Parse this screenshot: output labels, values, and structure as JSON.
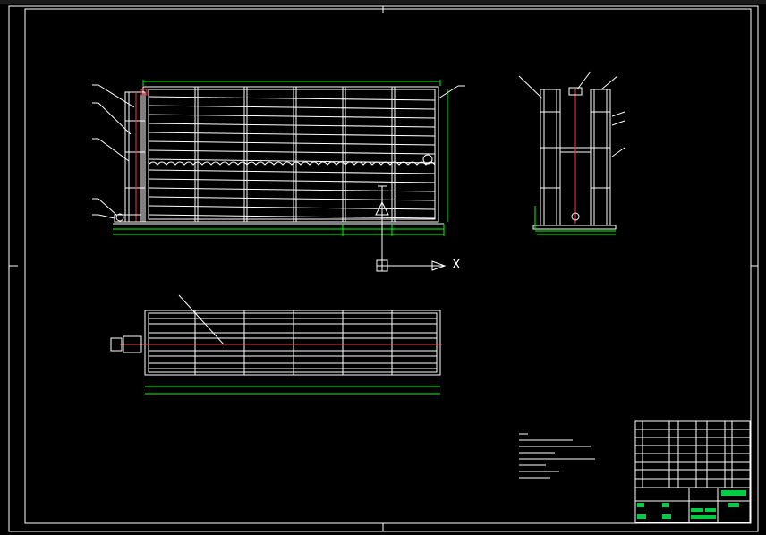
{
  "ucs": {
    "x_label": "X"
  },
  "colors": {
    "background": "#000000",
    "lines": "#ffffff",
    "dimension": "#00ff00",
    "accent": "#ff3333",
    "title_fill": "#00cc44"
  },
  "views": [
    {
      "name": "front-elevation"
    },
    {
      "name": "side-elevation"
    },
    {
      "name": "plan-view"
    }
  ],
  "title_block": {
    "present": true
  },
  "notes_block": {
    "present": true
  }
}
